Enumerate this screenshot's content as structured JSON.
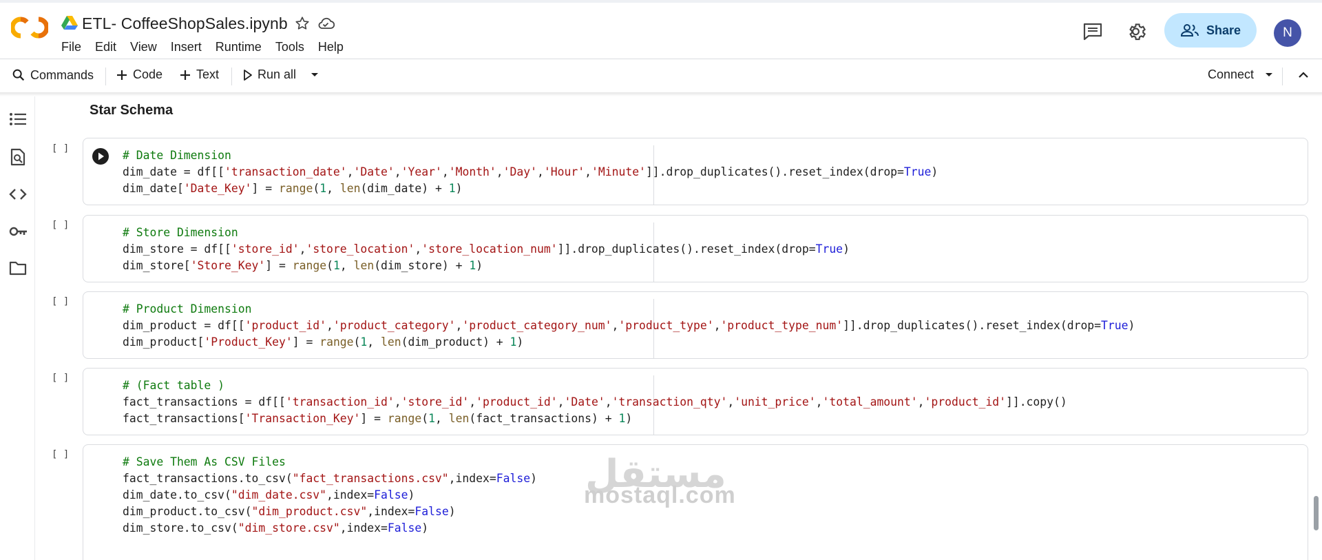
{
  "app": {
    "notebook_title": "ETL- CoffeeShopSales.ipynb",
    "menu": [
      "File",
      "Edit",
      "View",
      "Insert",
      "Runtime",
      "Tools",
      "Help"
    ],
    "share_label": "Share",
    "avatar_initial": "N"
  },
  "toolbar": {
    "commands_label": "Commands",
    "code_label": "Code",
    "text_label": "Text",
    "run_all_label": "Run all",
    "connect_label": "Connect"
  },
  "notebook": {
    "section_title": "Star Schema",
    "cells": [
      {
        "bracket": "[ ]",
        "lines": [
          "# Date Dimension",
          "dim_date = df[['transaction_date','Date','Year','Month','Day','Hour','Minute']].drop_duplicates().reset_index(drop=True)",
          "dim_date['Date_Key'] = range(1, len(dim_date) + 1)"
        ]
      },
      {
        "bracket": "[ ]",
        "lines": [
          "# Store Dimension",
          "dim_store = df[['store_id','store_location','store_location_num']].drop_duplicates().reset_index(drop=True)",
          "dim_store['Store_Key'] = range(1, len(dim_store) + 1)"
        ]
      },
      {
        "bracket": "[ ]",
        "lines": [
          "# Product Dimension",
          "dim_product = df[['product_id','product_category','product_category_num','product_type','product_type_num']].drop_duplicates().reset_index(drop=True)",
          "dim_product['Product_Key'] = range(1, len(dim_product) + 1)"
        ]
      },
      {
        "bracket": "[ ]",
        "lines": [
          "# (Fact table )",
          "fact_transactions = df[['transaction_id','store_id','product_id','Date','transaction_qty','unit_price','total_amount','product_id']].copy()",
          "fact_transactions['Transaction_Key'] = range(1, len(fact_transactions) + 1)"
        ]
      },
      {
        "bracket": "[ ]",
        "lines": [
          "# Save Them As CSV Files",
          "fact_transactions.to_csv(\"fact_transactions.csv\",index=False)",
          "dim_date.to_csv(\"dim_date.csv\",index=False)",
          "dim_product.to_csv(\"dim_product.csv\",index=False)",
          "dim_store.to_csv(\"dim_store.csv\",index=False)"
        ]
      }
    ]
  },
  "watermark": {
    "arabic": "مستقل",
    "latin": "mostaql.com"
  },
  "colors": {
    "share_bg": "#c2e7ff",
    "avatar_bg": "#4554a8",
    "comment": "#0e7a0e",
    "string": "#a31515",
    "number": "#098658",
    "keyword": "#1d1dd8"
  }
}
